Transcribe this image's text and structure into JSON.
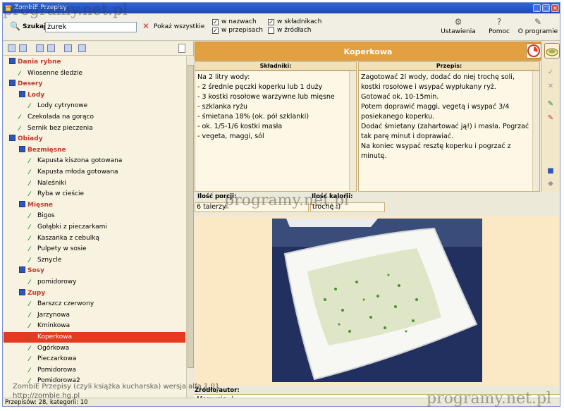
{
  "window": {
    "title": "ZombiE Przepisy"
  },
  "toolbar": {
    "search_label": "Szukaj:",
    "search_value": "żurek",
    "show_all_label": "Pokaż wszystkie",
    "checkboxes": [
      {
        "label": "w nazwach",
        "checked": true
      },
      {
        "label": "w przepisach",
        "checked": true
      },
      {
        "label": "w składnikach",
        "checked": true
      },
      {
        "label": "w źródłach",
        "checked": false
      }
    ],
    "settings_label": "Ustawienia",
    "help_label": "Pomoc",
    "about_label": "O programie"
  },
  "tree": {
    "items": [
      {
        "label": "Dania rybne",
        "level": 0,
        "type": "category"
      },
      {
        "label": "Wiosenne śledzie",
        "level": 1,
        "type": "recipe"
      },
      {
        "label": "Desery",
        "level": 0,
        "type": "category"
      },
      {
        "label": "Lody",
        "level": 1,
        "type": "category"
      },
      {
        "label": "Lody cytrynowe",
        "level": 2,
        "type": "recipe"
      },
      {
        "label": "Czekolada na gorąco",
        "level": 1,
        "type": "recipe"
      },
      {
        "label": "Sernik bez pieczenia",
        "level": 1,
        "type": "recipe"
      },
      {
        "label": "Obiady",
        "level": 0,
        "type": "category"
      },
      {
        "label": "Bezmięsne",
        "level": 1,
        "type": "category"
      },
      {
        "label": "Kapusta kiszona gotowana",
        "level": 2,
        "type": "recipe"
      },
      {
        "label": "Kapusta młoda gotowana",
        "level": 2,
        "type": "recipe"
      },
      {
        "label": "Naleśniki",
        "level": 2,
        "type": "recipe"
      },
      {
        "label": "Ryba w cieście",
        "level": 2,
        "type": "recipe"
      },
      {
        "label": "Mięsne",
        "level": 1,
        "type": "category"
      },
      {
        "label": "Bigos",
        "level": 2,
        "type": "recipe"
      },
      {
        "label": "Gołąbki z pieczarkami",
        "level": 2,
        "type": "recipe"
      },
      {
        "label": "Kaszanka z cebulką",
        "level": 2,
        "type": "recipe"
      },
      {
        "label": "Pulpety w sosie",
        "level": 2,
        "type": "recipe"
      },
      {
        "label": "Sznycle",
        "level": 2,
        "type": "recipe"
      },
      {
        "label": "Sosy",
        "level": 1,
        "type": "category"
      },
      {
        "label": "pomidorowy",
        "level": 2,
        "type": "recipe"
      },
      {
        "label": "Zupy",
        "level": 1,
        "type": "category"
      },
      {
        "label": "Barszcz czerwony",
        "level": 2,
        "type": "recipe"
      },
      {
        "label": "Jarzynowa",
        "level": 2,
        "type": "recipe"
      },
      {
        "label": "Kminkowa",
        "level": 2,
        "type": "recipe"
      },
      {
        "label": "Koperkowa",
        "level": 2,
        "type": "recipe",
        "selected": true
      },
      {
        "label": "Ogórkowa",
        "level": 2,
        "type": "recipe"
      },
      {
        "label": "Pieczarkowa",
        "level": 2,
        "type": "recipe"
      },
      {
        "label": "Pomidorowa",
        "level": 2,
        "type": "recipe"
      },
      {
        "label": "Pomidorowa2",
        "level": 2,
        "type": "recipe"
      }
    ]
  },
  "recipe": {
    "title": "Koperkowa",
    "ingredients_header": "Składniki:",
    "instructions_header": "Przepis:",
    "ingredients": [
      "Na 2 litry wody:",
      "- 2 średnie pęczki koperku lub 1 duży",
      "- 3 kostki rosołowe warzywne lub mięsne",
      "- szklanka ryżu",
      "- śmietana 18% (ok. pół szklanki)",
      "- ok. 1/5-1/6 kostki masła",
      "- vegeta, maggi, sól"
    ],
    "instructions": [
      "Zagotować 2l wody, dodać do niej trochę soli, kostki rosołowe i wsypać wypłukany ryż.",
      "Gotować ok. 10-15min.",
      "Potem doprawić maggi, vegetą i wsypać 3/4 posiekanego koperku.",
      "Dodać śmietany (zahartować ją!) i masła. Pogrzać tak parę minut i doprawiać.",
      "Na koniec wsypać resztę koperku i pogrzać z minutę."
    ],
    "portions_label": "Ilość porcji:",
    "portions_value": "6 talerzy",
    "calories_label": "Ilość kalorii:",
    "calories_value": "trochę :)",
    "source_label": "Źródło/autor:",
    "source_value": "Mamusia :)"
  },
  "status": {
    "text": "Przepisów: 28, kategorii: 10"
  },
  "overlay": {
    "caption": "ZombiE Przepisy (czyli książka kucharska) wersja alfa 1.01",
    "url": "http://zombie.hg.pl"
  },
  "watermark": "programy.net.pl",
  "colors": {
    "header": "#e3a041",
    "selected": "#e63a20",
    "category_text": "#c0392b",
    "title_bar": "#2f64d6"
  }
}
